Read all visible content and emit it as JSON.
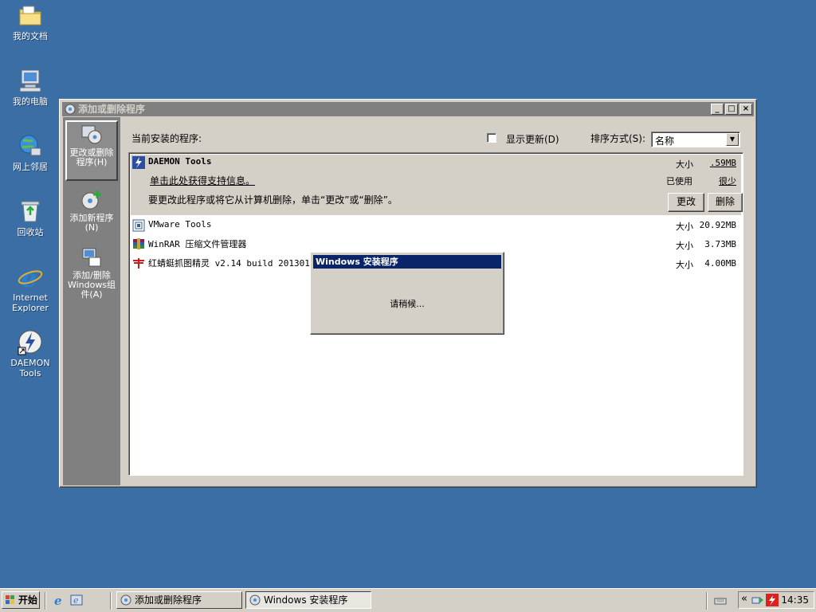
{
  "desktop": {
    "icons": [
      {
        "label": "我的文档"
      },
      {
        "label": "我的电脑"
      },
      {
        "label": "网上邻居"
      },
      {
        "label": "回收站"
      },
      {
        "label": "Internet Explorer"
      },
      {
        "label": "DAEMON Tools"
      }
    ]
  },
  "window": {
    "title": "添加或删除程序",
    "buttons": {
      "minimize": "_",
      "maximize": "□",
      "close": "×"
    },
    "sidebar": [
      {
        "label": "更改或删除程序(H)"
      },
      {
        "label": "添加新程序(N)"
      },
      {
        "label": "添加/删除Windows组件(A)"
      }
    ],
    "current_label": "当前安装的程序:",
    "show_updates_label": "显示更新(D)",
    "show_updates_checked": false,
    "sort_label": "排序方式(S):",
    "sort_value": "名称",
    "programs": [
      {
        "name": "DAEMON Tools",
        "selected": true,
        "support_link": "单击此处获得支持信息。",
        "instructions": "要更改此程序或将它从计算机删除，单击“更改”或“删除”。",
        "size_label": "大小",
        "size": ".59MB",
        "used_label": "已使用",
        "used": "很少",
        "change_button": "更改",
        "remove_button": "删除"
      },
      {
        "name": "VMware Tools",
        "size_label": "大小",
        "size": "20.92MB"
      },
      {
        "name": "WinRAR 压缩文件管理器",
        "size_label": "大小",
        "size": "3.73MB"
      },
      {
        "name": "红蜻蜓抓图精灵 v2.14 build 2013010",
        "size_label": "大小",
        "size": "4.00MB"
      }
    ]
  },
  "dialog": {
    "title": "Windows 安装程序",
    "message": "请稍候..."
  },
  "taskbar": {
    "start_label": "开始",
    "tasks": [
      {
        "label": "添加或删除程序",
        "active": false
      },
      {
        "label": "Windows 安装程序",
        "active": true
      }
    ],
    "tray_chevron": "«",
    "clock": "14:35"
  },
  "colors": {
    "desktop": "#3a6ea5",
    "dialog_title": "#0a246a",
    "inactive_title": "#808080",
    "face": "#d4d0c8"
  }
}
